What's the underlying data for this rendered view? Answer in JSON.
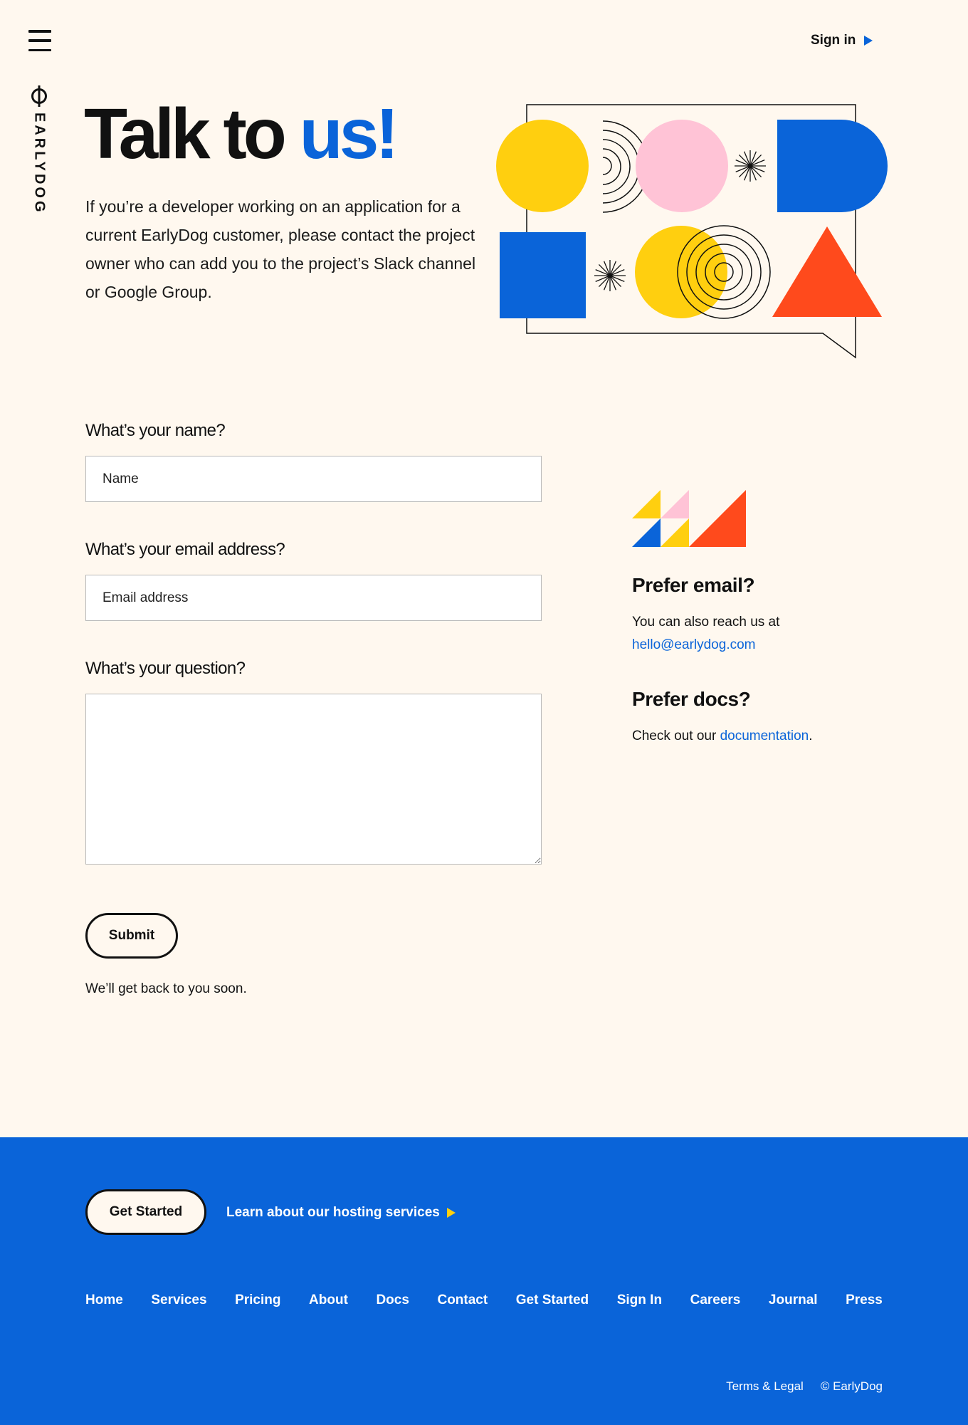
{
  "header": {
    "menu_icon": "hamburger-menu-icon",
    "brand": "EARLYDOG",
    "sign_in_label": "Sign in",
    "accent_color": "#0a64d9"
  },
  "hero": {
    "title_main": "Talk to ",
    "title_accent": "us!",
    "description": "If you’re a developer working on an application for a current EarlyDog customer, please contact the project owner who can add you to the project’s Slack channel or Google Group."
  },
  "form": {
    "name_question": "What’s your name?",
    "name_placeholder": "Name",
    "email_question": "What’s your email address?",
    "email_placeholder": "Email address",
    "question_label": "What’s your question?",
    "question_value": "",
    "submit_label": "Submit",
    "after_note": "We’ll get back to you soon."
  },
  "sidebar": {
    "email_heading": "Prefer email?",
    "email_text": "You can also reach us at",
    "email_address": "hello@earlydog.com",
    "docs_heading": "Prefer docs?",
    "docs_prefix": "Check out our ",
    "docs_link": "documentation",
    "docs_suffix": "."
  },
  "footer": {
    "get_started_label": "Get Started",
    "hosting_link": "Learn about our hosting services",
    "nav": [
      "Home",
      "Services",
      "Pricing",
      "About",
      "Docs",
      "Contact",
      "Get Started",
      "Sign In",
      "Careers",
      "Journal",
      "Press"
    ],
    "terms": "Terms & Legal",
    "copyright": "© EarlyDog",
    "background_color": "#0a64d9"
  },
  "palette": {
    "yellow": "#ffcf0f",
    "pink": "#ffc3d6",
    "blue": "#0a64d9",
    "orange": "#ff4a1c",
    "page_bg": "#fff8ef"
  }
}
